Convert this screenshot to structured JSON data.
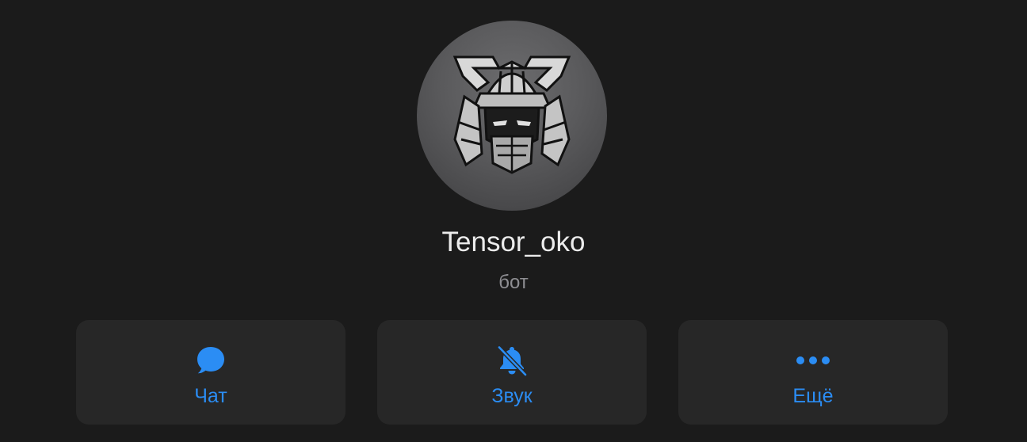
{
  "profile": {
    "name": "Tensor_oko",
    "subtitle": "бот",
    "avatar_icon": "samurai-mask-avatar"
  },
  "actions": [
    {
      "label": "Чат",
      "icon": "chat-bubble-icon"
    },
    {
      "label": "Звук",
      "icon": "bell-muted-icon"
    },
    {
      "label": "Ещё",
      "icon": "more-dots-icon"
    }
  ],
  "colors": {
    "background": "#1b1b1b",
    "card": "#272727",
    "accent": "#2b8df4",
    "name_text": "#ececec",
    "subtitle_text": "#8e8e92"
  }
}
